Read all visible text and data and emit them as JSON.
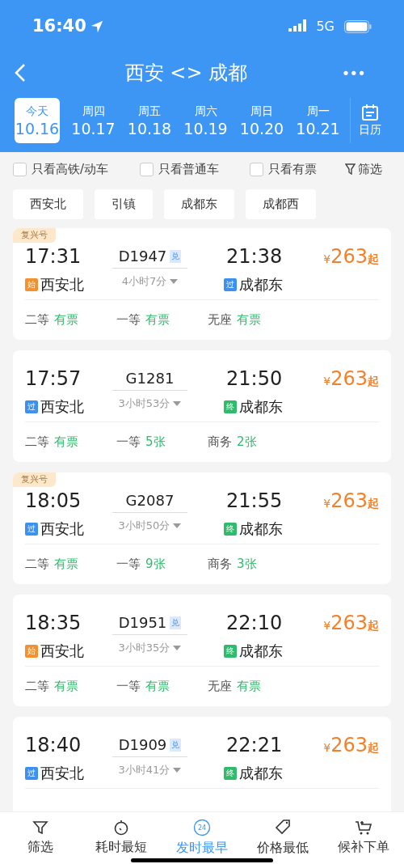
{
  "status_bar": {
    "time": "16:40",
    "network": "5G"
  },
  "header": {
    "title": "西安 <> 成都",
    "more": "•••"
  },
  "dates": [
    {
      "weekday": "今天",
      "date": "10.16",
      "selected": true
    },
    {
      "weekday": "周四",
      "date": "10.17",
      "selected": false
    },
    {
      "weekday": "周五",
      "date": "10.18",
      "selected": false
    },
    {
      "weekday": "周六",
      "date": "10.19",
      "selected": false
    },
    {
      "weekday": "周日",
      "date": "10.20",
      "selected": false
    },
    {
      "weekday": "周一",
      "date": "10.21",
      "selected": false
    }
  ],
  "calendar_label": "日历",
  "filters": [
    {
      "label": "只看高铁/动车",
      "checked": false
    },
    {
      "label": "只看普通车",
      "checked": false
    },
    {
      "label": "只看有票",
      "checked": false
    }
  ],
  "filter_button": "筛选",
  "stations": [
    "西安北",
    "引镇",
    "成都东",
    "成都西"
  ],
  "trains": [
    {
      "tag": "复兴号",
      "depart": "17:31",
      "number": "D1947",
      "mark": "兑",
      "arrive": "21:38",
      "from_badge": {
        "kind": "start",
        "text": "始"
      },
      "from": "西安北",
      "duration": "4小时7分",
      "to_badge": {
        "kind": "pass",
        "text": "过"
      },
      "to": "成都东",
      "price": "263",
      "currency": "¥",
      "price_suffix": "起",
      "seats": [
        {
          "class": "二等",
          "avail": "有票"
        },
        {
          "class": "一等",
          "avail": "有票"
        },
        {
          "class": "无座",
          "avail": "有票"
        }
      ]
    },
    {
      "depart": "17:57",
      "number": "G1281",
      "arrive": "21:50",
      "from_badge": {
        "kind": "pass",
        "text": "过"
      },
      "from": "西安北",
      "duration": "3小时53分",
      "to_badge": {
        "kind": "end",
        "text": "终"
      },
      "to": "成都东",
      "price": "263",
      "currency": "¥",
      "price_suffix": "起",
      "seats": [
        {
          "class": "二等",
          "avail": "有票"
        },
        {
          "class": "一等",
          "avail": "5张"
        },
        {
          "class": "商务",
          "avail": "2张"
        }
      ]
    },
    {
      "tag": "复兴号",
      "depart": "18:05",
      "number": "G2087",
      "arrive": "21:55",
      "from_badge": {
        "kind": "pass",
        "text": "过"
      },
      "from": "西安北",
      "duration": "3小时50分",
      "to_badge": {
        "kind": "end",
        "text": "终"
      },
      "to": "成都东",
      "price": "263",
      "currency": "¥",
      "price_suffix": "起",
      "seats": [
        {
          "class": "二等",
          "avail": "有票"
        },
        {
          "class": "一等",
          "avail": "9张"
        },
        {
          "class": "商务",
          "avail": "3张"
        }
      ]
    },
    {
      "depart": "18:35",
      "number": "D1951",
      "mark": "兑",
      "arrive": "22:10",
      "from_badge": {
        "kind": "start",
        "text": "始"
      },
      "from": "西安北",
      "duration": "3小时35分",
      "to_badge": {
        "kind": "end",
        "text": "终"
      },
      "to": "成都东",
      "price": "263",
      "currency": "¥",
      "price_suffix": "起",
      "seats": [
        {
          "class": "二等",
          "avail": "有票"
        },
        {
          "class": "一等",
          "avail": "有票"
        },
        {
          "class": "无座",
          "avail": "有票"
        }
      ]
    },
    {
      "depart": "18:40",
      "number": "D1909",
      "mark": "兑",
      "arrive": "22:21",
      "from_badge": {
        "kind": "pass",
        "text": "过"
      },
      "from": "西安北",
      "duration": "3小时41分",
      "to_badge": {
        "kind": "end",
        "text": "终"
      },
      "to": "成都东",
      "price": "263",
      "currency": "¥",
      "price_suffix": "起"
    }
  ],
  "bottom_tabs": [
    {
      "kind": "filter",
      "label": "筛选",
      "selected": false
    },
    {
      "kind": "timer",
      "label": "耗时最短",
      "selected": false
    },
    {
      "kind": "clock24",
      "label": "发时最早",
      "selected": true,
      "icon_text": "24"
    },
    {
      "kind": "tag",
      "label": "价格最低",
      "selected": false
    },
    {
      "kind": "cart",
      "label": "候补下单",
      "selected": false
    }
  ]
}
